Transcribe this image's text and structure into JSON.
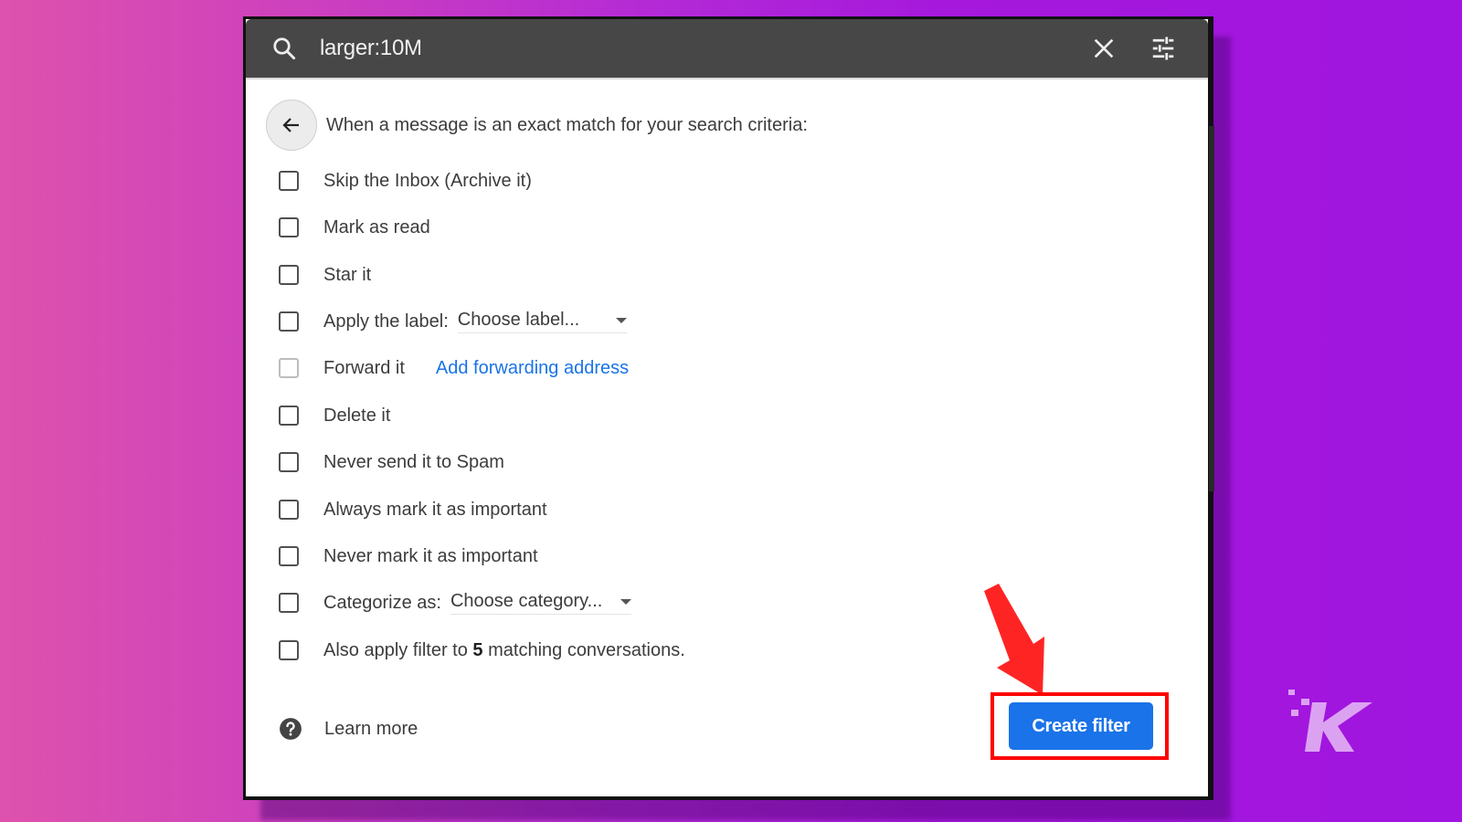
{
  "search": {
    "query": "larger:10M",
    "search_icon": "search-icon",
    "clear_icon": "close-icon",
    "options_icon": "tune-icon"
  },
  "criteria": {
    "back_icon": "arrow-back-icon",
    "text": "When a message is an exact match for your search criteria:"
  },
  "options": [
    {
      "label": "Skip the Inbox (Archive it)",
      "checked": false,
      "disabled": false
    },
    {
      "label": "Mark as read",
      "checked": false,
      "disabled": false
    },
    {
      "label": "Star it",
      "checked": false,
      "disabled": false
    },
    {
      "label": "Apply the label:",
      "checked": false,
      "disabled": false,
      "select_value": "Choose label..."
    },
    {
      "label": "Forward it",
      "checked": false,
      "disabled": true,
      "link": "Add forwarding address"
    },
    {
      "label": "Delete it",
      "checked": false,
      "disabled": false
    },
    {
      "label": "Never send it to Spam",
      "checked": false,
      "disabled": false
    },
    {
      "label": "Always mark it as important",
      "checked": false,
      "disabled": false
    },
    {
      "label": "Never mark it as important",
      "checked": false,
      "disabled": false
    },
    {
      "label": "Categorize as:",
      "checked": false,
      "disabled": false,
      "select_value": "Choose category..."
    },
    {
      "label_prefix": "Also apply filter to ",
      "count": "5",
      "label_suffix": " matching conversations.",
      "checked": false,
      "disabled": false
    }
  ],
  "footer": {
    "learn_more": "Learn more",
    "help_icon": "help-icon",
    "create_filter": "Create filter"
  },
  "annotations": {
    "arrow_color": "#ff2020",
    "highlight_color": "#ff0000"
  },
  "colors": {
    "primary": "#1a73e8",
    "link": "#1a73e8",
    "search_bar": "#474747"
  },
  "watermark": {
    "logo": "K"
  }
}
